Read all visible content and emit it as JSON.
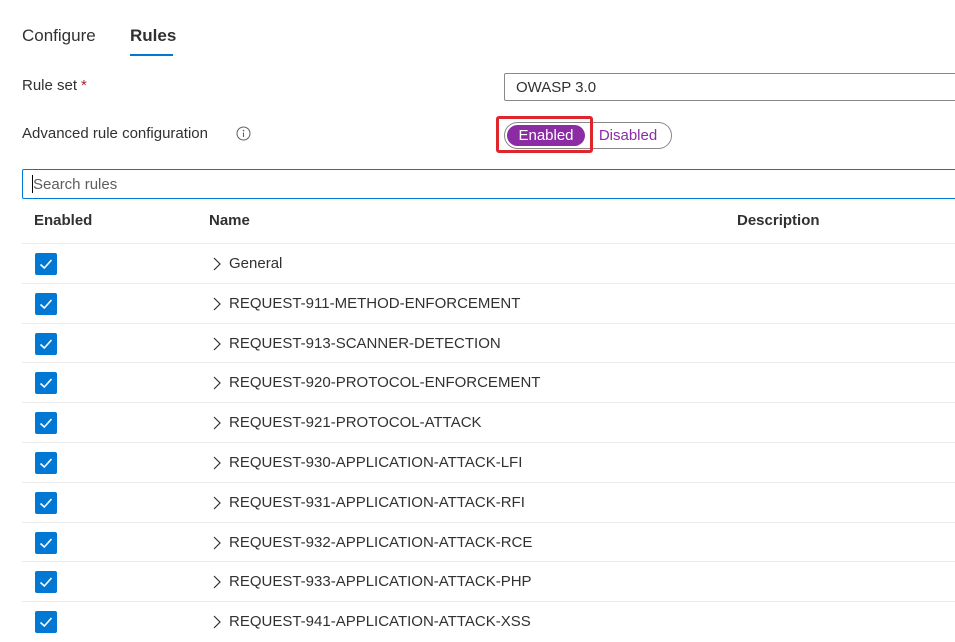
{
  "tabs": [
    {
      "label": "Configure",
      "active": false
    },
    {
      "label": "Rules",
      "active": true
    }
  ],
  "rule_set": {
    "label": "Rule set",
    "required_mark": "*",
    "value": "OWASP 3.0"
  },
  "advanced": {
    "label": "Advanced rule configuration",
    "info_icon": "info-icon",
    "options": [
      "Enabled",
      "Disabled"
    ],
    "selected": "Enabled"
  },
  "search": {
    "placeholder": "Search rules",
    "value": ""
  },
  "table": {
    "headers": {
      "enabled": "Enabled",
      "name": "Name",
      "description": "Description"
    },
    "rows": [
      {
        "enabled": true,
        "name": "General"
      },
      {
        "enabled": true,
        "name": "REQUEST-911-METHOD-ENFORCEMENT"
      },
      {
        "enabled": true,
        "name": "REQUEST-913-SCANNER-DETECTION"
      },
      {
        "enabled": true,
        "name": "REQUEST-920-PROTOCOL-ENFORCEMENT"
      },
      {
        "enabled": true,
        "name": "REQUEST-921-PROTOCOL-ATTACK"
      },
      {
        "enabled": true,
        "name": "REQUEST-930-APPLICATION-ATTACK-LFI"
      },
      {
        "enabled": true,
        "name": "REQUEST-931-APPLICATION-ATTACK-RFI"
      },
      {
        "enabled": true,
        "name": "REQUEST-932-APPLICATION-ATTACK-RCE"
      },
      {
        "enabled": true,
        "name": "REQUEST-933-APPLICATION-ATTACK-PHP"
      },
      {
        "enabled": true,
        "name": "REQUEST-941-APPLICATION-ATTACK-XSS"
      }
    ]
  },
  "colors": {
    "accent": "#0078d4",
    "toggle_selected": "#8b2ca5",
    "highlight": "#e0262d",
    "required": "#a4262c"
  }
}
